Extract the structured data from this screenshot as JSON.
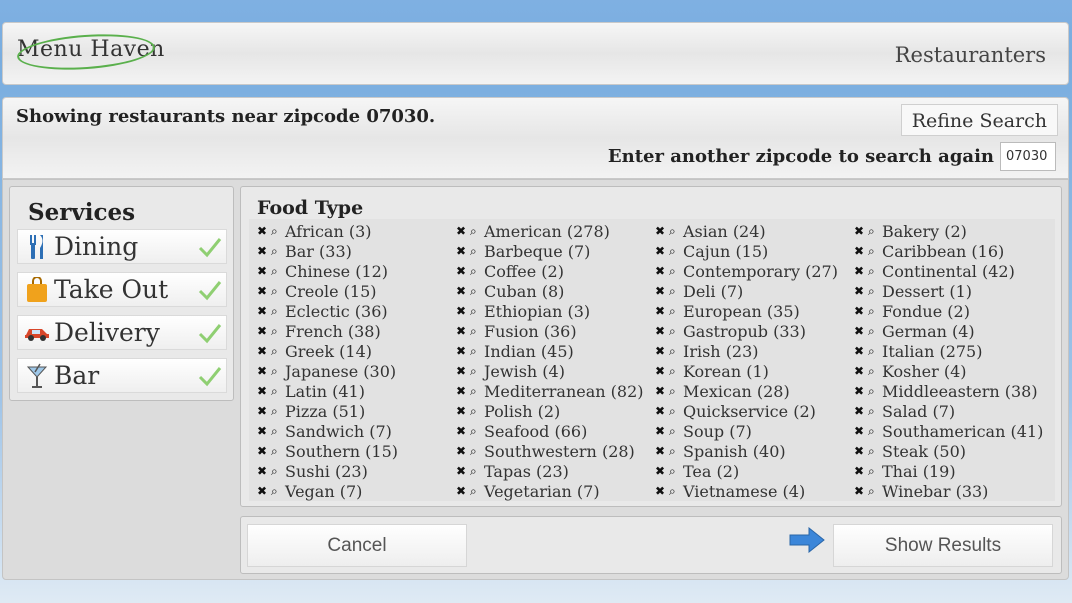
{
  "header": {
    "logo": "Menu Haven",
    "restaurateurs": "Restauranters"
  },
  "search": {
    "showing": "Showing restaurants near zipcode 07030.",
    "refine_label": "Refine Search",
    "zip_label": "Enter another zipcode to search again",
    "zip_value": "07030"
  },
  "services": {
    "title": "Services",
    "items": [
      {
        "label": "Dining",
        "icon": "fork-knife-icon"
      },
      {
        "label": "Take Out",
        "icon": "bag-icon"
      },
      {
        "label": "Delivery",
        "icon": "car-icon"
      },
      {
        "label": "Bar",
        "icon": "cocktail-icon"
      }
    ]
  },
  "food": {
    "title": "Food Type",
    "items": [
      "African (3)",
      "American (278)",
      "Asian (24)",
      "Bakery (2)",
      "Bar (33)",
      "Barbeque (7)",
      "Cajun (15)",
      "Caribbean (16)",
      "Chinese (12)",
      "Coffee (2)",
      "Contemporary (27)",
      "Continental (42)",
      "Creole (15)",
      "Cuban (8)",
      "Deli (7)",
      "Dessert (1)",
      "Eclectic (36)",
      "Ethiopian (3)",
      "European (35)",
      "Fondue (2)",
      "French (38)",
      "Fusion (36)",
      "Gastropub (33)",
      "German (4)",
      "Greek (14)",
      "Indian (45)",
      "Irish (23)",
      "Italian (275)",
      "Japanese (30)",
      "Jewish (4)",
      "Korean (1)",
      "Kosher (4)",
      "Latin (41)",
      "Mediterranean (82)",
      "Mexican (28)",
      "Middleeastern (38)",
      "Pizza (51)",
      "Polish (2)",
      "Quickservice (2)",
      "Salad (7)",
      "Sandwich (7)",
      "Seafood (66)",
      "Soup (7)",
      "Southamerican (41)",
      "Southern (15)",
      "Southwestern (28)",
      "Spanish (40)",
      "Steak (50)",
      "Sushi (23)",
      "Tapas (23)",
      "Tea (2)",
      "Thai (19)",
      "Vegan (7)",
      "Vegetarian (7)",
      "Vietnamese (4)",
      "Winebar (33)"
    ]
  },
  "actions": {
    "cancel": "Cancel",
    "show_results": "Show Results"
  },
  "colors": {
    "check": "#8fcf72",
    "arrow": "#3b86d9"
  }
}
